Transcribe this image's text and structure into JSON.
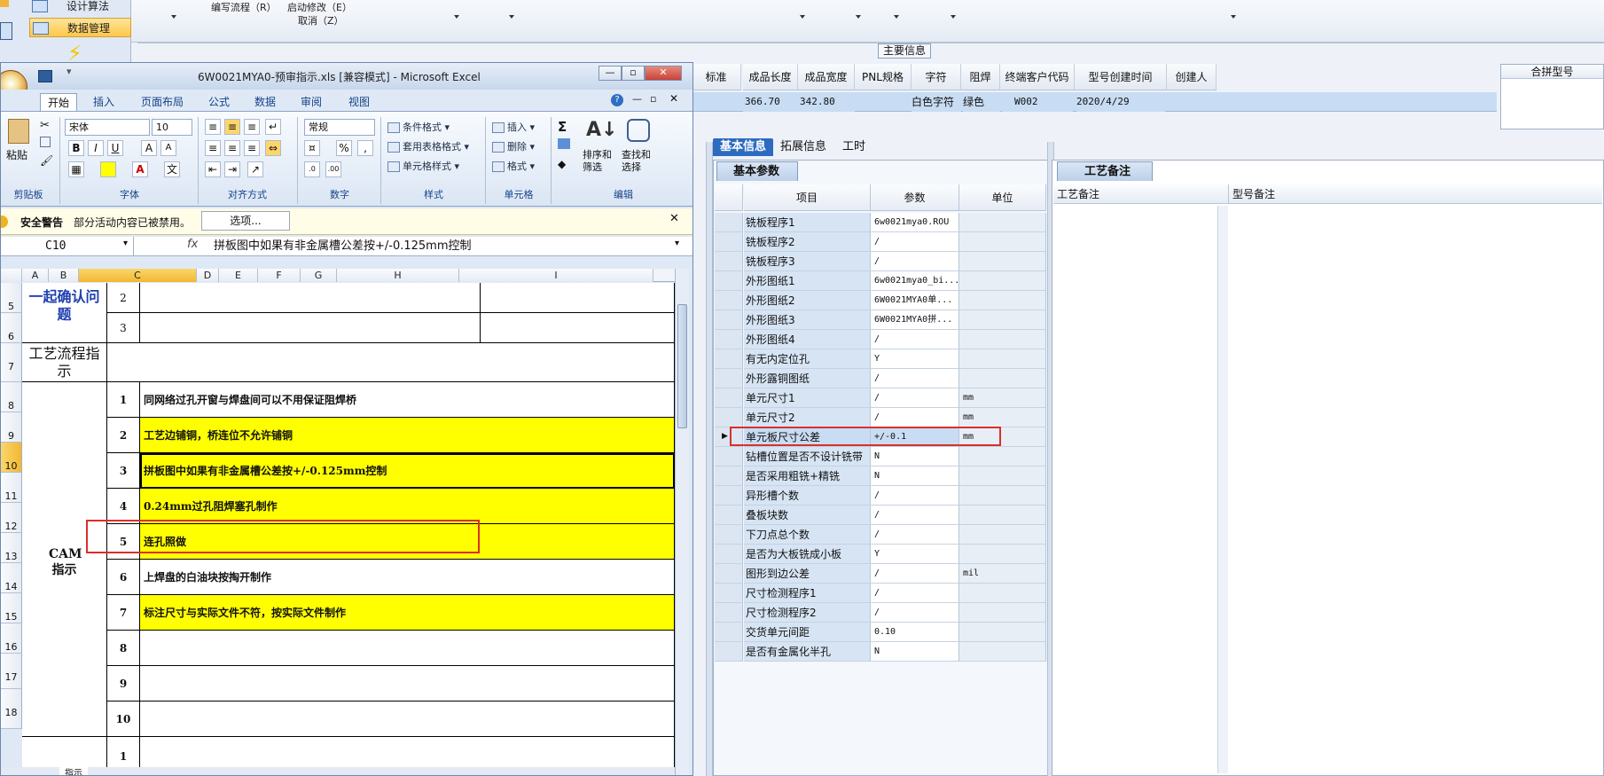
{
  "background_app": {
    "nav": {
      "design_algorithm": "设计算法",
      "data_management": "数据管理"
    },
    "menu": {
      "write_process": "编写流程（R）",
      "start_modify": "启动修改（E）",
      "cancel": "取消（Z）"
    },
    "section_title": "主要信息",
    "grid": {
      "headers": [
        "标准",
        "成品长度",
        "成品宽度",
        "PNL规格",
        "字符",
        "阻焊",
        "终端客户代码",
        "型号创建时间",
        "创建人"
      ],
      "row": [
        "",
        "366.70",
        "342.80",
        "",
        "白色字符",
        "绿色",
        "W002",
        "2020/4/29",
        ""
      ],
      "right_header": "合拼型号"
    },
    "tabs": [
      "基本信息",
      "拓展信息",
      "工时"
    ],
    "params": {
      "tab_label": "基本参数",
      "headers": [
        "项目",
        "参数",
        "单位"
      ],
      "rows": [
        {
          "item": "铣板程序1",
          "value": "6w0021mya0.ROU",
          "unit": ""
        },
        {
          "item": "铣板程序2",
          "value": "/",
          "unit": ""
        },
        {
          "item": "铣板程序3",
          "value": "/",
          "unit": ""
        },
        {
          "item": "外形图纸1",
          "value": "6w0021mya0_bi...",
          "unit": ""
        },
        {
          "item": "外形图纸2",
          "value": "6W0021MYA0单...",
          "unit": ""
        },
        {
          "item": "外形图纸3",
          "value": "6W0021MYA0拼...",
          "unit": ""
        },
        {
          "item": "外形图纸4",
          "value": "/",
          "unit": ""
        },
        {
          "item": "有无内定位孔",
          "value": "Y",
          "unit": ""
        },
        {
          "item": "外形露铜图纸",
          "value": "/",
          "unit": ""
        },
        {
          "item": "单元尺寸1",
          "value": "/",
          "unit": "mm"
        },
        {
          "item": "单元尺寸2",
          "value": "/",
          "unit": "mm"
        },
        {
          "item": "单元板尺寸公差",
          "value": "+/-0.1",
          "unit": "mm"
        },
        {
          "item": "钻槽位置是否不设计铣带",
          "value": "N",
          "unit": ""
        },
        {
          "item": "是否采用粗铣+精铣",
          "value": "N",
          "unit": ""
        },
        {
          "item": "异形槽个数",
          "value": "/",
          "unit": ""
        },
        {
          "item": "叠板块数",
          "value": "/",
          "unit": ""
        },
        {
          "item": "下刀点总个数",
          "value": "/",
          "unit": ""
        },
        {
          "item": "是否为大板铣成小板",
          "value": "Y",
          "unit": ""
        },
        {
          "item": "图形到边公差",
          "value": "/",
          "unit": "mil"
        },
        {
          "item": "尺寸检测程序1",
          "value": "/",
          "unit": ""
        },
        {
          "item": "尺寸检测程序2",
          "value": "/",
          "unit": ""
        },
        {
          "item": "交货单元间距",
          "value": "0.10",
          "unit": ""
        },
        {
          "item": "是否有金属化半孔",
          "value": "N",
          "unit": ""
        }
      ]
    },
    "notes": {
      "tab_label": "工艺备注",
      "col1": "工艺备注",
      "col2": "型号备注"
    }
  },
  "excel": {
    "title": "6W0021MYA0-预审指示.xls  [兼容模式] - Microsoft Excel",
    "ribbon_tabs": [
      "开始",
      "插入",
      "页面布局",
      "公式",
      "数据",
      "审阅",
      "视图"
    ],
    "font_name": "宋体",
    "font_size": "10",
    "number_format": "常规",
    "groups": [
      "剪贴板",
      "字体",
      "对齐方式",
      "数字",
      "样式",
      "单元格",
      "编辑"
    ],
    "buttons": {
      "paste": "粘贴",
      "cond_format": "条件格式",
      "table_format": "套用表格格式",
      "cell_style": "单元格样式",
      "insert": "插入",
      "delete": "删除",
      "format": "格式",
      "sort_filter": "排序和筛选",
      "find_select": "查找和选择"
    },
    "security": {
      "title": "安全警告",
      "message": "部分活动内容已被禁用。",
      "options": "选项..."
    },
    "name_box": "C10",
    "formula": "拼板图中如果有非金属槽公差按+/-0.125mm控制",
    "columns": [
      "A",
      "B",
      "C",
      "D",
      "E",
      "F",
      "G",
      "H",
      "I"
    ],
    "row_numbers": [
      "5",
      "6",
      "7",
      "8",
      "9",
      "10",
      "11",
      "12",
      "13",
      "14",
      "15",
      "16",
      "17",
      "18"
    ],
    "sheet": {
      "confirm_label": "一起确认问题",
      "confirm_rows": [
        "2",
        "3"
      ],
      "process_label": "工艺流程指示",
      "cam_label": "CAM指示",
      "cam_rows": [
        {
          "n": "1",
          "text": "同网络过孔开窗与焊盘间可以不用保证阻焊桥",
          "highlight": false
        },
        {
          "n": "2",
          "text": "工艺边铺铜，桥连位不允许铺铜",
          "highlight": true
        },
        {
          "n": "3",
          "text": "拼板图中如果有非金属槽公差按+/-0.125mm控制",
          "highlight": true
        },
        {
          "n": "4",
          "text": "0.24mm过孔阻焊塞孔制作",
          "highlight": true
        },
        {
          "n": "5",
          "text": "连孔照做",
          "highlight": true
        },
        {
          "n": "6",
          "text": "上焊盘的白油块按掏开制作",
          "highlight": false
        },
        {
          "n": "7",
          "text": "标注尺寸与实际文件不符，按实际文件制作",
          "highlight": true
        },
        {
          "n": "8",
          "text": "",
          "highlight": false
        },
        {
          "n": "9",
          "text": "",
          "highlight": false
        },
        {
          "n": "10",
          "text": "",
          "highlight": false
        }
      ],
      "last_row_n": "1"
    },
    "sheet_tab": "指示"
  }
}
